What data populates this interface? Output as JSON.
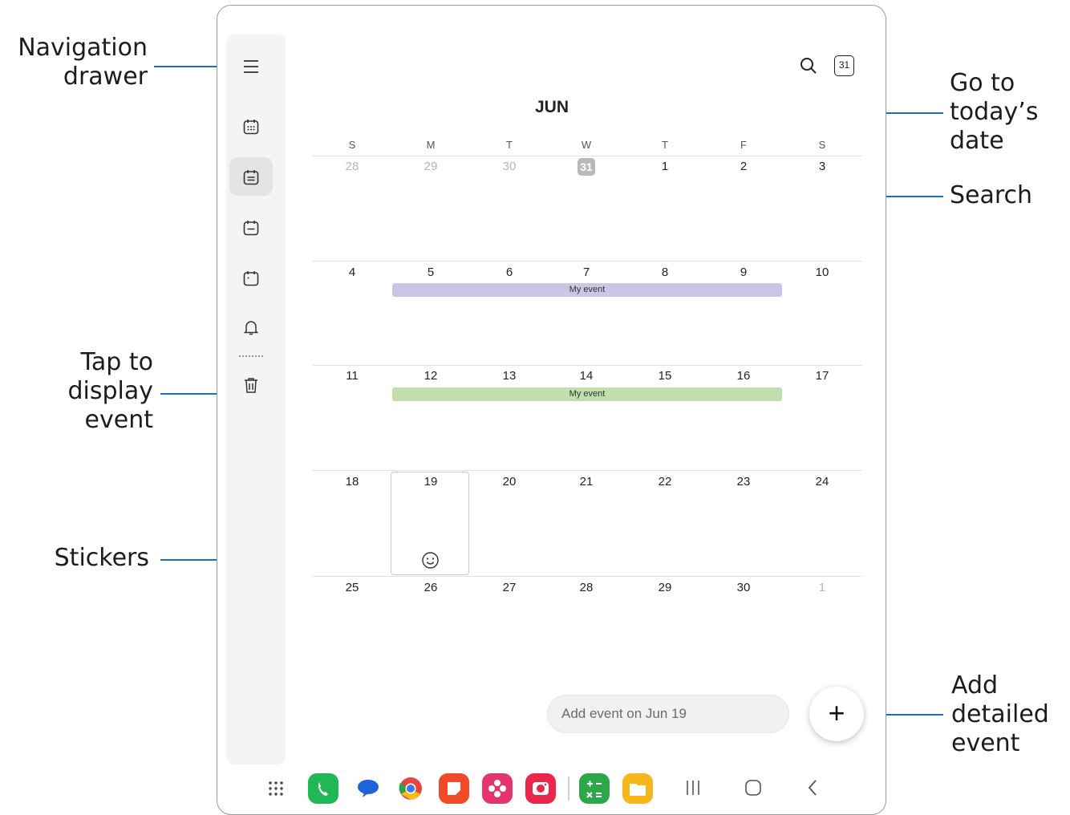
{
  "callouts": {
    "navigation_drawer": [
      "Navigation",
      "drawer"
    ],
    "go_to_today": [
      "Go to",
      "today’s",
      "date"
    ],
    "search": "Search",
    "tap_to_display": [
      "Tap to",
      "display",
      "event"
    ],
    "stickers": "Stickers",
    "add_detailed": [
      "Add",
      "detailed",
      "event"
    ]
  },
  "toolbar": {
    "today_icon_label": "31"
  },
  "calendar": {
    "month": "JUN",
    "weekdays": [
      "S",
      "M",
      "T",
      "W",
      "T",
      "F",
      "S"
    ],
    "weeks": [
      [
        "28",
        "29",
        "30",
        "31",
        "1",
        "2",
        "3"
      ],
      [
        "4",
        "5",
        "6",
        "7",
        "8",
        "9",
        "10"
      ],
      [
        "11",
        "12",
        "13",
        "14",
        "15",
        "16",
        "17"
      ],
      [
        "18",
        "19",
        "20",
        "21",
        "22",
        "23",
        "24"
      ],
      [
        "25",
        "26",
        "27",
        "28",
        "29",
        "30",
        "1"
      ]
    ],
    "today": "31",
    "selected_day": "19",
    "events": [
      {
        "title": "My event",
        "color": "#c9c6e6",
        "days": "5–9"
      },
      {
        "title": "My event",
        "color": "#bfe0ad",
        "days": "12–16"
      }
    ]
  },
  "quick_add": {
    "placeholder": "Add event on Jun 19"
  },
  "fab": {
    "label": "+"
  },
  "accent_color": "#1b6fb3",
  "rail_icons": [
    "menu-icon",
    "year-view-icon",
    "month-view-icon",
    "week-view-icon",
    "day-view-icon",
    "reminder-bell-icon",
    "trash-icon"
  ],
  "dock_apps": [
    "apps-grid-icon",
    "phone-icon",
    "messages-icon",
    "chrome-icon",
    "samsung-notes-icon",
    "gallery-icon",
    "camera-icon",
    "calculator-icon",
    "my-files-icon"
  ],
  "nav_bar": [
    "recents-icon",
    "home-icon",
    "back-icon"
  ]
}
